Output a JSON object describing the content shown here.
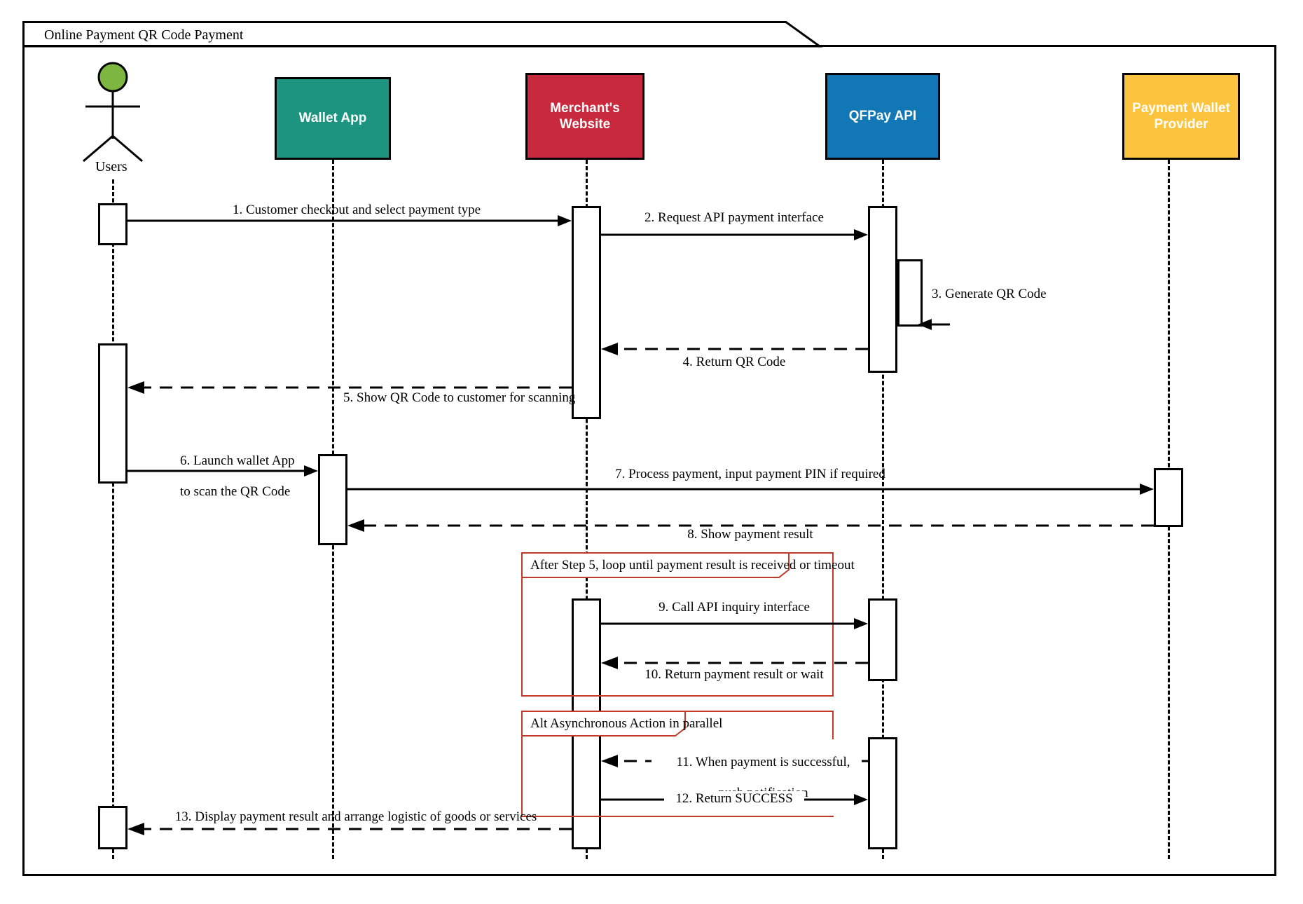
{
  "diagram": {
    "type": "uml-sequence-diagram",
    "frame_title": "Online Payment QR Code Payment",
    "colors": {
      "wallet_app": "#1C9480",
      "merchant_website": "#C8293C",
      "qfpay_api": "#1178B5",
      "payment_wallet_provider": "#FBC33E",
      "actor_head": "#7DB742",
      "fragment_border": "#C0392B",
      "line": "#000000",
      "background": "#FFFFFF"
    }
  },
  "participants": [
    {
      "id": "users",
      "label": "Users",
      "kind": "actor"
    },
    {
      "id": "wallet_app",
      "label": "Wallet App",
      "kind": "box",
      "color": "#1C9480"
    },
    {
      "id": "merchant_website",
      "label": "Merchant's\nWebsite",
      "line1": "Merchant's",
      "line2": "Website",
      "kind": "box",
      "color": "#C8293C"
    },
    {
      "id": "qfpay_api",
      "label": "QFPay API",
      "kind": "box",
      "color": "#1178B5"
    },
    {
      "id": "payment_wallet_provider",
      "label": "Payment Wallet\nProvider",
      "line1": "Payment Wallet",
      "line2": "Provider",
      "kind": "box",
      "color": "#FBC33E"
    }
  ],
  "messages": [
    {
      "num": "1",
      "text": "1. Customer checkout and select payment type",
      "from": "users",
      "to": "merchant_website",
      "style": "solid"
    },
    {
      "num": "2",
      "text": "2. Request API payment interface",
      "from": "merchant_website",
      "to": "qfpay_api",
      "style": "solid"
    },
    {
      "num": "3",
      "text": "3. Generate QR Code",
      "from": "qfpay_api",
      "to": "qfpay_api",
      "style": "self"
    },
    {
      "num": "4",
      "text": "4. Return QR Code",
      "from": "qfpay_api",
      "to": "merchant_website",
      "style": "dashed"
    },
    {
      "num": "5",
      "text": "5. Show QR Code to customer for scanning",
      "from": "merchant_website",
      "to": "users",
      "style": "dashed"
    },
    {
      "num": "6",
      "text": "6. Launch wallet App\nto scan the QR Code",
      "line1": "6. Launch wallet App",
      "line2": "to scan the QR Code",
      "from": "users",
      "to": "wallet_app",
      "style": "solid"
    },
    {
      "num": "7",
      "text": "7. Process payment, input payment PIN if required",
      "from": "wallet_app",
      "to": "payment_wallet_provider",
      "style": "solid"
    },
    {
      "num": "8",
      "text": "8. Show payment result",
      "from": "payment_wallet_provider",
      "to": "wallet_app",
      "style": "dashed"
    },
    {
      "num": "9",
      "text": "9. Call API inquiry interface",
      "from": "merchant_website",
      "to": "qfpay_api",
      "style": "solid"
    },
    {
      "num": "10",
      "text": "10. Return payment result or wait",
      "from": "qfpay_api",
      "to": "merchant_website",
      "style": "dashed"
    },
    {
      "num": "11",
      "text": "11. When payment is successful,\npush notification",
      "line1": "11. When payment is successful,",
      "line2": "push notification",
      "from": "qfpay_api",
      "to": "merchant_website",
      "style": "dashed"
    },
    {
      "num": "12",
      "text": "12. Return SUCCESS",
      "from": "merchant_website",
      "to": "qfpay_api",
      "style": "solid"
    },
    {
      "num": "13",
      "text": "13. Display payment result and arrange logistic of goods or services",
      "from": "merchant_website",
      "to": "users",
      "style": "dashed"
    }
  ],
  "fragments": [
    {
      "id": "loop",
      "label": "After Step 5, loop until payment result is received or timeout",
      "kind": "loop"
    },
    {
      "id": "alt",
      "label": "Alt Asynchronous Action in parallel",
      "kind": "alt"
    }
  ]
}
